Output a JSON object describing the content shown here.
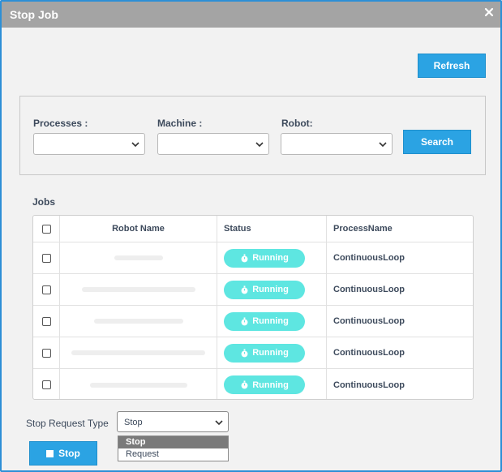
{
  "dialog": {
    "title": "Stop Job",
    "close_icon": "close-icon"
  },
  "toolbar": {
    "refresh_label": "Refresh"
  },
  "filters": {
    "processes_label": "Processes :",
    "machine_label": "Machine :",
    "robot_label": "Robot:",
    "processes_value": "",
    "machine_value": "",
    "robot_value": "",
    "search_label": "Search"
  },
  "jobs": {
    "section_title": "Jobs",
    "columns": [
      "Robot Name",
      "Status",
      "ProcessName"
    ],
    "rows": [
      {
        "robot_name": "",
        "status": "Running",
        "process_name": "ContinuousLoop"
      },
      {
        "robot_name": "",
        "status": "Running",
        "process_name": "ContinuousLoop"
      },
      {
        "robot_name": "",
        "status": "Running",
        "process_name": "ContinuousLoop"
      },
      {
        "robot_name": "",
        "status": "Running",
        "process_name": "ContinuousLoop"
      },
      {
        "robot_name": "",
        "status": "Running",
        "process_name": "ContinuousLoop"
      }
    ]
  },
  "stop_request": {
    "label": "Stop Request Type",
    "selected": "Stop",
    "options": [
      "Stop",
      "Request"
    ]
  },
  "actions": {
    "stop_label": "Stop"
  },
  "colors": {
    "accent": "#2ba3e3",
    "status_running": "#5ee6e1",
    "titlebar": "#a4a4a4",
    "border": "#2d8fd6"
  }
}
